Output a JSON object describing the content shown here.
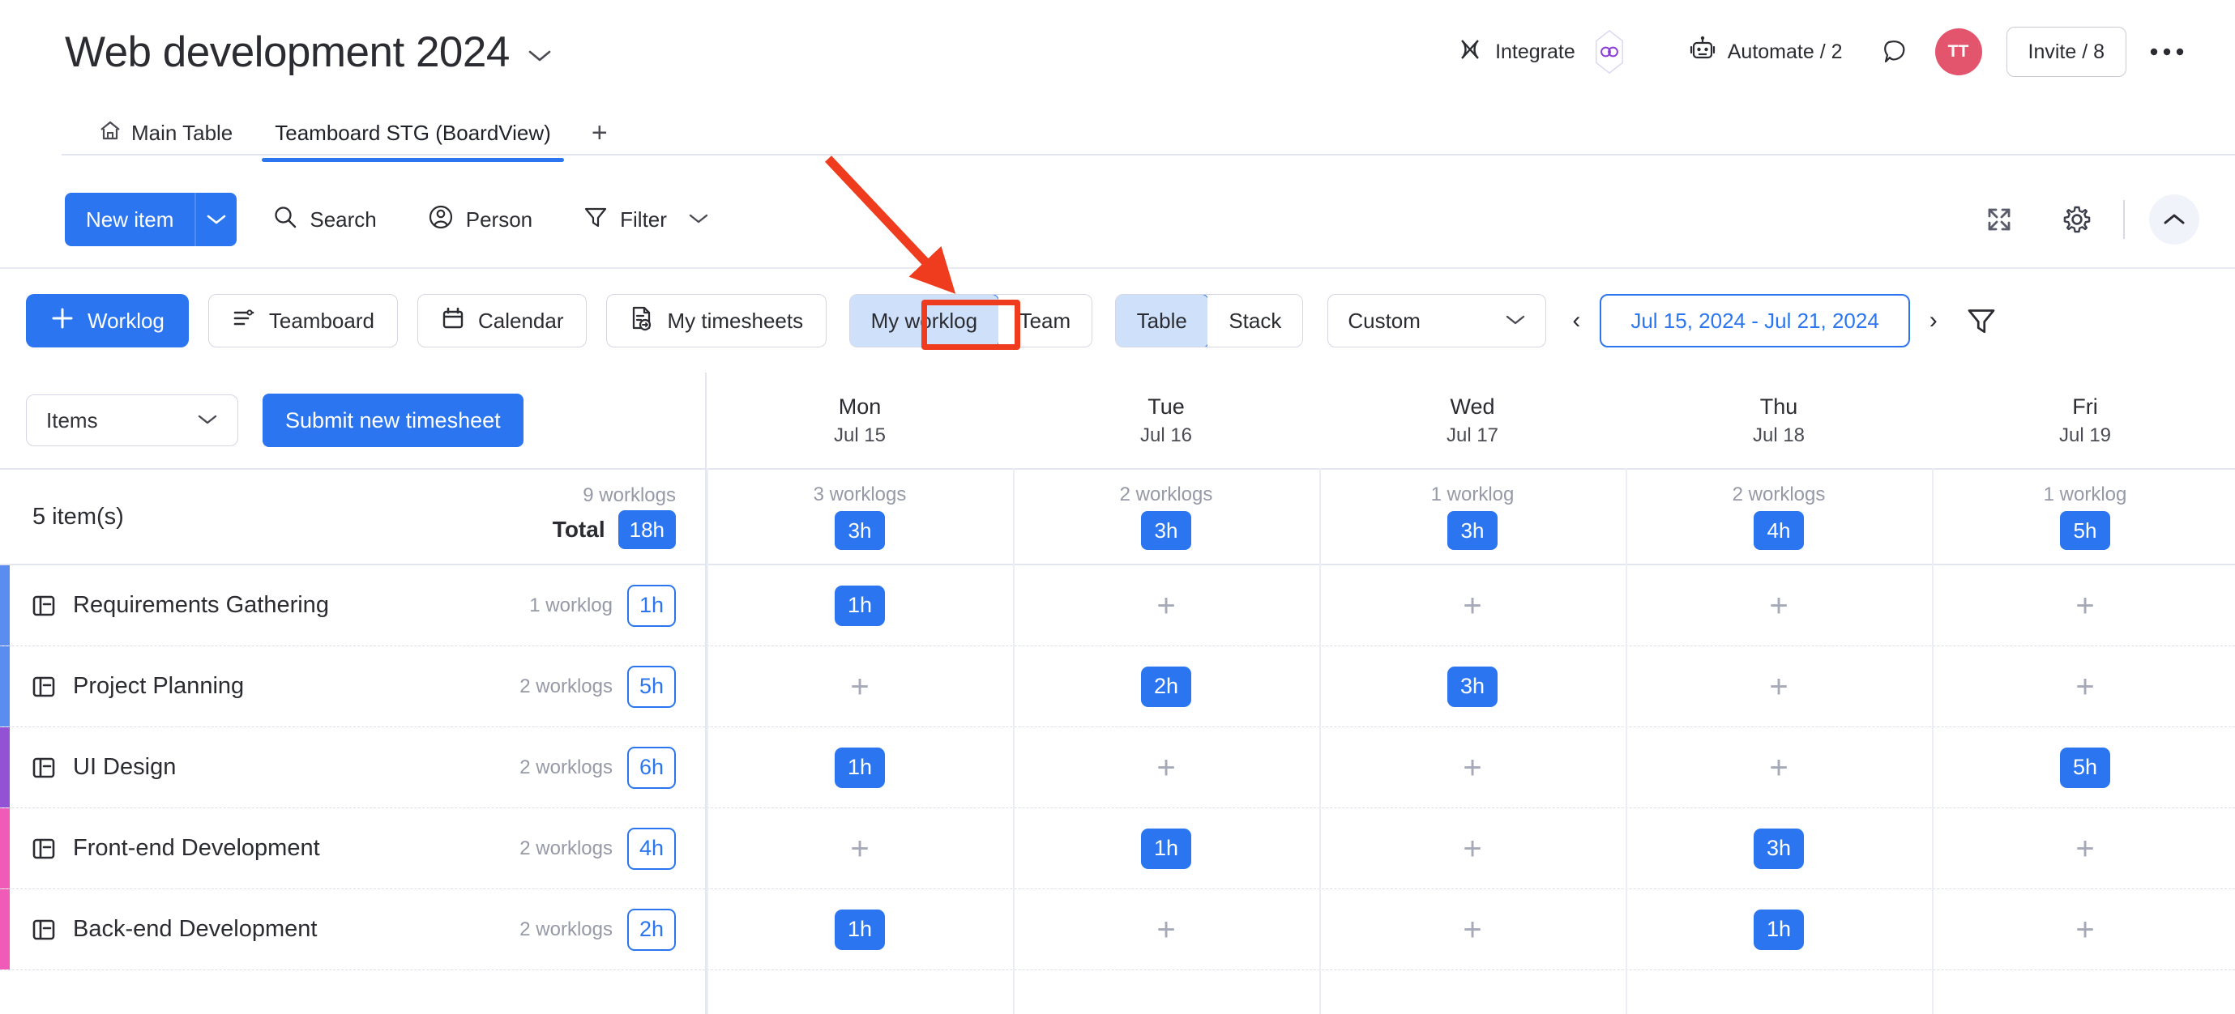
{
  "header": {
    "board_title": "Web development 2024",
    "title_chevron": "chevron-down-icon",
    "integrate_label": "Integrate",
    "automate_label": "Automate / 2",
    "invite_label": "Invite / 8",
    "avatar_initials": "TT",
    "more_label": "•••"
  },
  "tabs": {
    "items": [
      {
        "label": "Main Table",
        "icon": "home-icon",
        "active": false
      },
      {
        "label": "Teamboard STG (BoardView)",
        "icon": "",
        "active": true
      }
    ],
    "add_label": "+"
  },
  "toolbar": {
    "new_item_label": "New item",
    "new_item_chevron": "chevron-down-icon",
    "search_label": "Search",
    "person_label": "Person",
    "filter_label": "Filter",
    "filter_chevron": "chevron-down-icon",
    "expand_icon": "expand-icon",
    "settings_icon": "gear-icon",
    "collapse_icon": "chevron-up-icon"
  },
  "worklog_bar": {
    "worklog_button": "Worklog",
    "teamboard_button": "Teamboard",
    "calendar_button": "Calendar",
    "my_timesheets_button": "My timesheets",
    "scope_segment": [
      {
        "label": "My worklog",
        "active": true
      },
      {
        "label": "Team",
        "active": false
      }
    ],
    "layout_segment": [
      {
        "label": "Table",
        "active": true
      },
      {
        "label": "Stack",
        "active": false
      }
    ],
    "range_dropdown": "Custom",
    "range_dropdown_chevron": "chevron-down-icon",
    "prev_label": "‹",
    "next_label": "›",
    "date_range": "Jul 15, 2024 - Jul 21, 2024",
    "filter_icon": "filter-icon"
  },
  "table": {
    "items_dropdown": "Items",
    "items_dropdown_chevron": "chevron-down-icon",
    "submit_button": "Submit new timesheet",
    "day_columns": [
      {
        "dow": "Mon",
        "date": "Jul 15"
      },
      {
        "dow": "Tue",
        "date": "Jul 16"
      },
      {
        "dow": "Wed",
        "date": "Jul 17"
      },
      {
        "dow": "Thu",
        "date": "Jul 18"
      },
      {
        "dow": "Fri",
        "date": "Jul 19"
      }
    ],
    "summary": {
      "item_count": "5 item(s)",
      "worklogs": "9 worklogs",
      "total_label": "Total",
      "total_hours": "18h",
      "day_totals": [
        {
          "worklogs": "3 worklogs",
          "hours": "3h"
        },
        {
          "worklogs": "2 worklogs",
          "hours": "3h"
        },
        {
          "worklogs": "1 worklog",
          "hours": "3h"
        },
        {
          "worklogs": "2 worklogs",
          "hours": "4h"
        },
        {
          "worklogs": "1 worklog",
          "hours": "5h"
        }
      ]
    },
    "rows": [
      {
        "name": "Requirements Gathering",
        "icon": "item-board-icon",
        "color": "#5b8cf0",
        "worklogs": "1 worklog",
        "hours": "1h",
        "cells": [
          "1h",
          "",
          "",
          "",
          ""
        ]
      },
      {
        "name": "Project Planning",
        "icon": "item-board-icon",
        "color": "#5b8cf0",
        "worklogs": "2 worklogs",
        "hours": "5h",
        "cells": [
          "",
          "2h",
          "3h",
          "",
          ""
        ]
      },
      {
        "name": "UI Design",
        "icon": "item-board-icon",
        "color": "#9352d4",
        "worklogs": "2 worklogs",
        "hours": "6h",
        "cells": [
          "1h",
          "",
          "",
          "",
          "5h"
        ]
      },
      {
        "name": "Front-end Development",
        "icon": "item-board-icon",
        "color": "#ef5bb6",
        "worklogs": "2 worklogs",
        "hours": "4h",
        "cells": [
          "",
          "1h",
          "",
          "3h",
          ""
        ]
      },
      {
        "name": "Back-end Development",
        "icon": "item-board-icon",
        "color": "#ef5bb6",
        "worklogs": "2 worklogs",
        "hours": "2h",
        "cells": [
          "1h",
          "",
          "",
          "1h",
          ""
        ]
      }
    ],
    "empty_cell_symbol": "+"
  },
  "annotation": {
    "arrow_color": "#ef3b1e",
    "box_color": "#ef3b1e",
    "target": "My worklog"
  },
  "colors": {
    "accent_blue": "#2b76f0",
    "active_fill": "#cfe0fb",
    "muted_text": "#9699a6",
    "avatar_bg": "#e2556c"
  }
}
